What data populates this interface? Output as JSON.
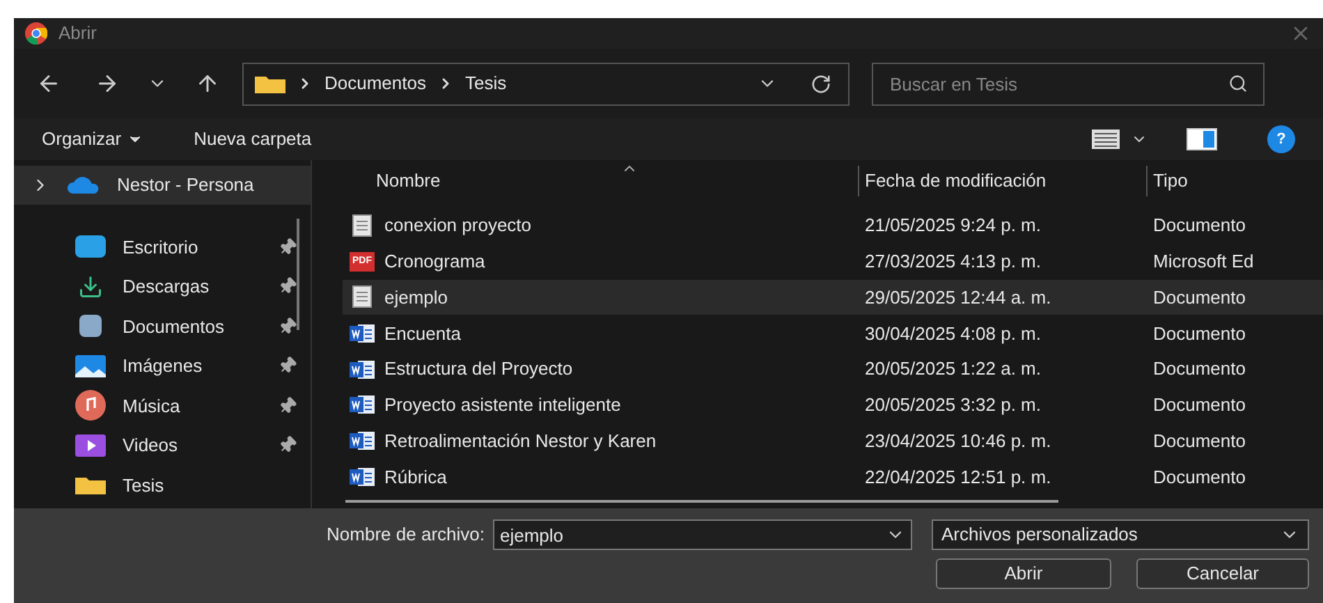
{
  "window": {
    "title": "Abrir"
  },
  "address": {
    "segments": [
      "Documentos",
      "Tesis"
    ]
  },
  "search": {
    "placeholder": "Buscar en Tesis"
  },
  "commands": {
    "organize": "Organizar",
    "new_folder": "Nueva carpeta",
    "help": "?"
  },
  "pdf_badge": "PDF",
  "sidebar": {
    "top": {
      "label": "Nestor - Persona",
      "selected": true
    },
    "items": [
      {
        "label": "Escritorio",
        "kind": "desktop"
      },
      {
        "label": "Descargas",
        "kind": "downloads"
      },
      {
        "label": "Documentos",
        "kind": "documents"
      },
      {
        "label": "Imágenes",
        "kind": "pictures"
      },
      {
        "label": "Música",
        "kind": "music"
      },
      {
        "label": "Videos",
        "kind": "videos"
      },
      {
        "label": "Tesis",
        "kind": "folder"
      }
    ]
  },
  "table": {
    "columns": [
      "Nombre",
      "Fecha de modificación",
      "Tipo"
    ],
    "rows": [
      {
        "name": "conexion proyecto",
        "date": "21/05/2025 9:24 p. m.",
        "type": "Documento",
        "kind": "text",
        "selected": false
      },
      {
        "name": "Cronograma",
        "date": "27/03/2025 4:13 p. m.",
        "type": "Microsoft Ed",
        "kind": "pdf",
        "selected": false
      },
      {
        "name": "ejemplo",
        "date": "29/05/2025 12:44 a. m.",
        "type": "Documento",
        "kind": "text",
        "selected": true
      },
      {
        "name": "Encuenta",
        "date": "30/04/2025 4:08 p. m.",
        "type": "Documento",
        "kind": "word",
        "selected": false
      },
      {
        "name": "Estructura del Proyecto",
        "date": "20/05/2025 1:22 a. m.",
        "type": "Documento",
        "kind": "word",
        "selected": false
      },
      {
        "name": "Proyecto asistente inteligente",
        "date": "20/05/2025 3:32 p. m.",
        "type": "Documento",
        "kind": "word",
        "selected": false
      },
      {
        "name": "Retroalimentación Nestor y Karen",
        "date": "23/04/2025 10:46 p. m.",
        "type": "Documento",
        "kind": "word",
        "selected": false
      },
      {
        "name": "Rúbrica",
        "date": "22/04/2025 12:51 p. m.",
        "type": "Documento",
        "kind": "word",
        "selected": false
      }
    ]
  },
  "footer": {
    "filename_label": "Nombre de archivo:",
    "filename": "ejemplo",
    "filter": "Archivos personalizados",
    "open": "Abrir",
    "cancel": "Cancelar"
  }
}
